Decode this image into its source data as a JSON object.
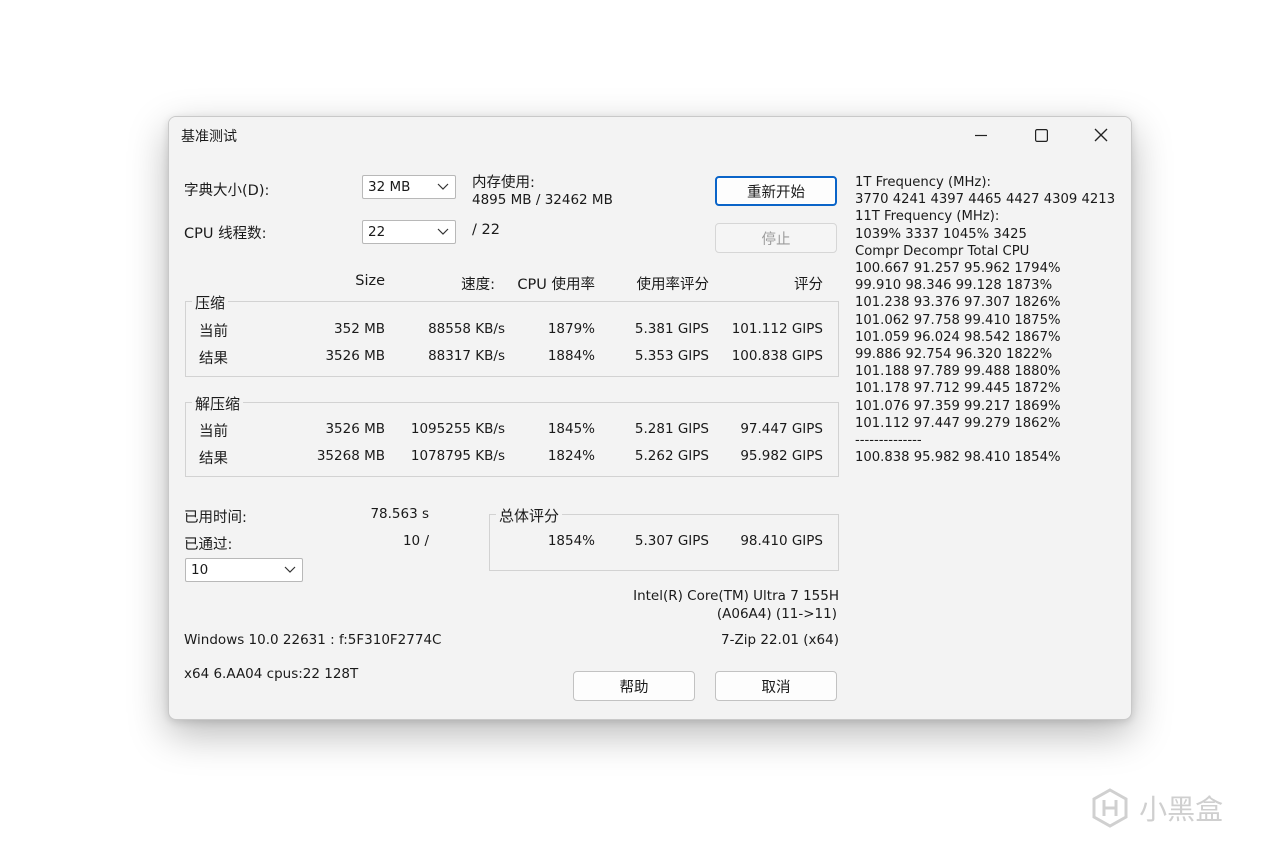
{
  "window": {
    "title": "基准测试"
  },
  "settings": {
    "dict_label": "字典大小(D):",
    "dict_value": "32 MB",
    "threads_label": "CPU 线程数:",
    "threads_value": "22",
    "threads_total": "/ 22",
    "mem_label": "内存使用:",
    "mem_value": "4895 MB / 32462 MB"
  },
  "buttons": {
    "restart": "重新开始",
    "stop": "停止",
    "help": "帮助",
    "cancel": "取消"
  },
  "columns": {
    "size": "Size",
    "speed": "速度:",
    "cpu_usage": "CPU 使用率",
    "usage_rating": "使用率评分",
    "rating": "评分"
  },
  "compression": {
    "label": "压缩",
    "rows": [
      {
        "name": "当前",
        "size": "352 MB",
        "speed": "88558 KB/s",
        "cpu": "1879%",
        "usage_rating": "5.381 GIPS",
        "rating": "101.112 GIPS"
      },
      {
        "name": "结果",
        "size": "3526 MB",
        "speed": "88317 KB/s",
        "cpu": "1884%",
        "usage_rating": "5.353 GIPS",
        "rating": "100.838 GIPS"
      }
    ]
  },
  "decompression": {
    "label": "解压缩",
    "rows": [
      {
        "name": "当前",
        "size": "3526 MB",
        "speed": "1095255 KB/s",
        "cpu": "1845%",
        "usage_rating": "5.281 GIPS",
        "rating": "97.447 GIPS"
      },
      {
        "name": "结果",
        "size": "35268 MB",
        "speed": "1078795 KB/s",
        "cpu": "1824%",
        "usage_rating": "5.262 GIPS",
        "rating": "95.982 GIPS"
      }
    ]
  },
  "stats": {
    "elapsed_label": "已用时间:",
    "elapsed_value": "78.563 s",
    "passes_label": "已通过:",
    "passes_value": "10 /",
    "passes_select": "10"
  },
  "total": {
    "label": "总体评分",
    "cpu": "1854%",
    "usage_rating": "5.307 GIPS",
    "rating": "98.410 GIPS"
  },
  "system": {
    "cpu_name": "Intel(R) Core(TM) Ultra 7 155H",
    "cpu_id": "(A06A4) (11->11)",
    "os": "Windows 10.0 22631 : f:5F310F2774C",
    "version": "7-Zip 22.01 (x64)",
    "arch": "x64 6.AA04 cpus:22 128T"
  },
  "log": {
    "lines": [
      "1T Frequency (MHz):",
      " 3770 4241 4397 4465 4427 4309 4213",
      "11T Frequency (MHz):",
      " 1039% 3337 1045% 3425",
      "Compr Decompr Total   CPU",
      "100.667  91.257  95.962  1794%",
      "99.910  98.346  99.128  1873%",
      "101.238  93.376  97.307  1826%",
      "101.062  97.758  99.410  1875%",
      "101.059  96.024  98.542  1867%",
      "99.886  92.754  96.320  1822%",
      "101.188  97.789  99.488  1880%",
      "101.178  97.712  99.445  1872%",
      "101.076  97.359  99.217  1869%",
      "101.112  97.447  99.279  1862%",
      "--------------",
      "100.838  95.982  98.410  1854%"
    ]
  },
  "watermark": {
    "text": "小黑盒"
  }
}
